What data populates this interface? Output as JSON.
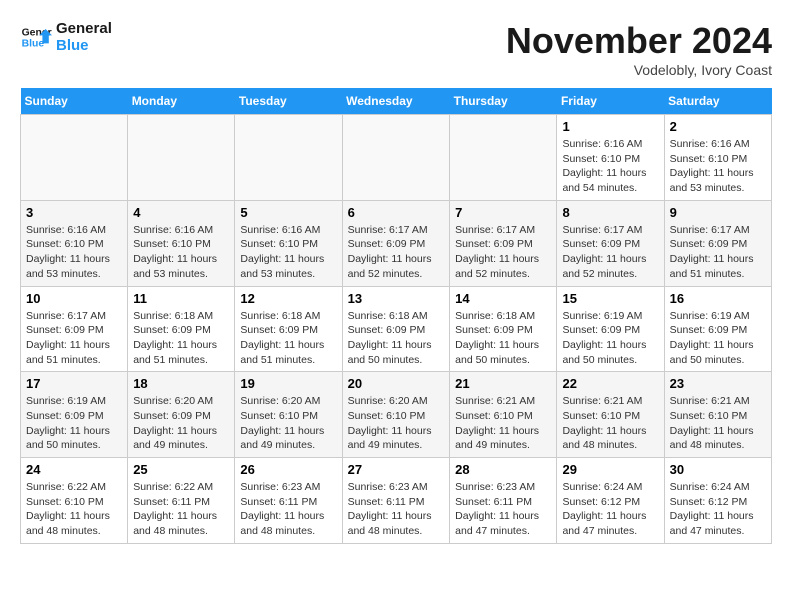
{
  "logo": {
    "line1": "General",
    "line2": "Blue"
  },
  "title": "November 2024",
  "location": "Vodelobly, Ivory Coast",
  "days_of_week": [
    "Sunday",
    "Monday",
    "Tuesday",
    "Wednesday",
    "Thursday",
    "Friday",
    "Saturday"
  ],
  "weeks": [
    [
      {
        "day": "",
        "info": ""
      },
      {
        "day": "",
        "info": ""
      },
      {
        "day": "",
        "info": ""
      },
      {
        "day": "",
        "info": ""
      },
      {
        "day": "",
        "info": ""
      },
      {
        "day": "1",
        "info": "Sunrise: 6:16 AM\nSunset: 6:10 PM\nDaylight: 11 hours and 54 minutes."
      },
      {
        "day": "2",
        "info": "Sunrise: 6:16 AM\nSunset: 6:10 PM\nDaylight: 11 hours and 53 minutes."
      }
    ],
    [
      {
        "day": "3",
        "info": "Sunrise: 6:16 AM\nSunset: 6:10 PM\nDaylight: 11 hours and 53 minutes."
      },
      {
        "day": "4",
        "info": "Sunrise: 6:16 AM\nSunset: 6:10 PM\nDaylight: 11 hours and 53 minutes."
      },
      {
        "day": "5",
        "info": "Sunrise: 6:16 AM\nSunset: 6:10 PM\nDaylight: 11 hours and 53 minutes."
      },
      {
        "day": "6",
        "info": "Sunrise: 6:17 AM\nSunset: 6:09 PM\nDaylight: 11 hours and 52 minutes."
      },
      {
        "day": "7",
        "info": "Sunrise: 6:17 AM\nSunset: 6:09 PM\nDaylight: 11 hours and 52 minutes."
      },
      {
        "day": "8",
        "info": "Sunrise: 6:17 AM\nSunset: 6:09 PM\nDaylight: 11 hours and 52 minutes."
      },
      {
        "day": "9",
        "info": "Sunrise: 6:17 AM\nSunset: 6:09 PM\nDaylight: 11 hours and 51 minutes."
      }
    ],
    [
      {
        "day": "10",
        "info": "Sunrise: 6:17 AM\nSunset: 6:09 PM\nDaylight: 11 hours and 51 minutes."
      },
      {
        "day": "11",
        "info": "Sunrise: 6:18 AM\nSunset: 6:09 PM\nDaylight: 11 hours and 51 minutes."
      },
      {
        "day": "12",
        "info": "Sunrise: 6:18 AM\nSunset: 6:09 PM\nDaylight: 11 hours and 51 minutes."
      },
      {
        "day": "13",
        "info": "Sunrise: 6:18 AM\nSunset: 6:09 PM\nDaylight: 11 hours and 50 minutes."
      },
      {
        "day": "14",
        "info": "Sunrise: 6:18 AM\nSunset: 6:09 PM\nDaylight: 11 hours and 50 minutes."
      },
      {
        "day": "15",
        "info": "Sunrise: 6:19 AM\nSunset: 6:09 PM\nDaylight: 11 hours and 50 minutes."
      },
      {
        "day": "16",
        "info": "Sunrise: 6:19 AM\nSunset: 6:09 PM\nDaylight: 11 hours and 50 minutes."
      }
    ],
    [
      {
        "day": "17",
        "info": "Sunrise: 6:19 AM\nSunset: 6:09 PM\nDaylight: 11 hours and 50 minutes."
      },
      {
        "day": "18",
        "info": "Sunrise: 6:20 AM\nSunset: 6:09 PM\nDaylight: 11 hours and 49 minutes."
      },
      {
        "day": "19",
        "info": "Sunrise: 6:20 AM\nSunset: 6:10 PM\nDaylight: 11 hours and 49 minutes."
      },
      {
        "day": "20",
        "info": "Sunrise: 6:20 AM\nSunset: 6:10 PM\nDaylight: 11 hours and 49 minutes."
      },
      {
        "day": "21",
        "info": "Sunrise: 6:21 AM\nSunset: 6:10 PM\nDaylight: 11 hours and 49 minutes."
      },
      {
        "day": "22",
        "info": "Sunrise: 6:21 AM\nSunset: 6:10 PM\nDaylight: 11 hours and 48 minutes."
      },
      {
        "day": "23",
        "info": "Sunrise: 6:21 AM\nSunset: 6:10 PM\nDaylight: 11 hours and 48 minutes."
      }
    ],
    [
      {
        "day": "24",
        "info": "Sunrise: 6:22 AM\nSunset: 6:10 PM\nDaylight: 11 hours and 48 minutes."
      },
      {
        "day": "25",
        "info": "Sunrise: 6:22 AM\nSunset: 6:11 PM\nDaylight: 11 hours and 48 minutes."
      },
      {
        "day": "26",
        "info": "Sunrise: 6:23 AM\nSunset: 6:11 PM\nDaylight: 11 hours and 48 minutes."
      },
      {
        "day": "27",
        "info": "Sunrise: 6:23 AM\nSunset: 6:11 PM\nDaylight: 11 hours and 48 minutes."
      },
      {
        "day": "28",
        "info": "Sunrise: 6:23 AM\nSunset: 6:11 PM\nDaylight: 11 hours and 47 minutes."
      },
      {
        "day": "29",
        "info": "Sunrise: 6:24 AM\nSunset: 6:12 PM\nDaylight: 11 hours and 47 minutes."
      },
      {
        "day": "30",
        "info": "Sunrise: 6:24 AM\nSunset: 6:12 PM\nDaylight: 11 hours and 47 minutes."
      }
    ]
  ]
}
